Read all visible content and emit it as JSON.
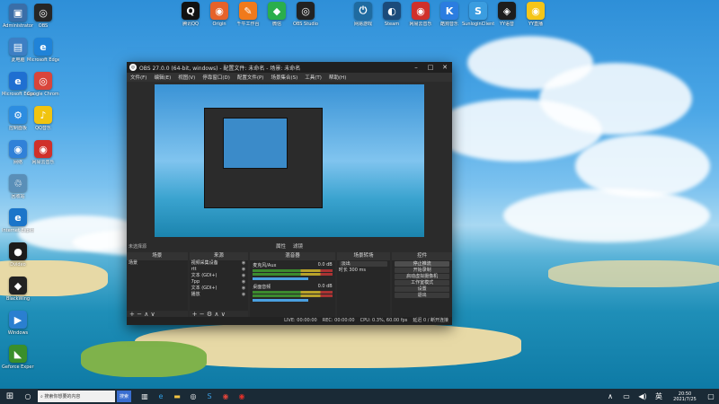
{
  "desktop": {
    "icons": [
      {
        "label": "Administrator",
        "glyph": "▣",
        "color": "#3a6ea8"
      },
      {
        "label": "此电脑",
        "glyph": "▤",
        "color": "#3d7fc4"
      },
      {
        "label": "Microsoft Edge",
        "glyph": "e",
        "color": "#1f6fd1"
      },
      {
        "label": "控制面板",
        "glyph": "⚙",
        "color": "#2d8de0"
      },
      {
        "label": "网络",
        "glyph": "◉",
        "color": "#3081d8"
      },
      {
        "label": "回收站",
        "glyph": "♲",
        "color": "#5a8fb8"
      },
      {
        "label": "Internet Explorer",
        "glyph": "e",
        "color": "#1b75c9"
      },
      {
        "label": "Dvideo",
        "glyph": "●",
        "color": "#1c1c1c"
      },
      {
        "label": "BlackWing",
        "glyph": "◆",
        "color": "#222"
      },
      {
        "label": "Windows",
        "glyph": "▶",
        "color": "#2a7fd0"
      },
      {
        "label": "Geforce Experience",
        "glyph": "◣",
        "color": "#3a8f2a"
      },
      {
        "label": "OBS",
        "glyph": "◎",
        "color": "#262626"
      },
      {
        "label": "Microsoft Edge",
        "glyph": "e",
        "color": "#2083d8"
      },
      {
        "label": "Google Chrome",
        "glyph": "◎",
        "color": "#d9453b"
      },
      {
        "label": "QQ音乐",
        "glyph": "♪",
        "color": "#f1c40f"
      },
      {
        "label": "网易云音乐",
        "glyph": "◉",
        "color": "#d0302a"
      }
    ],
    "top_icons": [
      {
        "label": "腾讯QQ",
        "glyph": "Q",
        "color": "#111"
      },
      {
        "label": "Origin",
        "glyph": "◉",
        "color": "#e5622a"
      },
      {
        "label": "千牛工作台",
        "glyph": "✎",
        "color": "#f07a1c"
      },
      {
        "label": "微信",
        "glyph": "◆",
        "color": "#2aae4b"
      },
      {
        "label": "OBS Studio",
        "glyph": "◎",
        "color": "#222"
      },
      {
        "label": "网易游戏",
        "glyph": "⏻",
        "color": "#1f6ba0"
      },
      {
        "label": "Steam",
        "glyph": "◐",
        "color": "#1b4b7a"
      },
      {
        "label": "网易云音乐",
        "glyph": "◉",
        "color": "#d0302a"
      },
      {
        "label": "酷狗音乐",
        "glyph": "K",
        "color": "#2b7de0"
      },
      {
        "label": "SunloginClient",
        "glyph": "S",
        "color": "#3b9de0"
      },
      {
        "label": "YY语音",
        "glyph": "◈",
        "color": "#1d1d1d"
      },
      {
        "label": "YY直播",
        "glyph": "◉",
        "color": "#f5c518"
      }
    ]
  },
  "obs": {
    "title": "OBS 27.0.0 (64-bit, windows) - 配置文件: 未命名 - 场景: 未命名",
    "menu": [
      "文件(F)",
      "编辑(E)",
      "视图(V)",
      "停靠窗口(D)",
      "配置文件(P)",
      "场景集合(S)",
      "工具(T)",
      "帮助(H)"
    ],
    "no_source": "未选择源",
    "preview_controls": [
      "属性",
      "滤镜"
    ],
    "docks": {
      "scenes": {
        "header": "场景",
        "items": [
          "场景"
        ]
      },
      "sources": {
        "header": "来源",
        "items": [
          "视频采集设备",
          "rtt",
          "文本 (GDI+)",
          "7pp",
          "文本 (GDI+)",
          "播放"
        ]
      },
      "mixer": {
        "header": "混音器",
        "channels": [
          {
            "name": "麦克风/Aux",
            "level": "0.0 dB"
          },
          {
            "name": "桌面音频",
            "level": "0.0 dB"
          }
        ]
      },
      "transitions": {
        "header": "场景转场",
        "type": "淡出",
        "duration_label": "时长",
        "duration": "300 ms"
      },
      "controls": {
        "header": "控件",
        "buttons": [
          "停止推流",
          "开始录制",
          "启动虚拟摄像机",
          "工作室模式",
          "设置",
          "退出"
        ]
      }
    },
    "status": {
      "live": "LIVE: 00:00:00",
      "rec": "REC: 00:00:00",
      "cpu": "CPU: 0.3%, 60.00 fps",
      "delay": "延迟 0 / 断开连接"
    }
  },
  "taskbar": {
    "search_placeholder": "搜索你想要的内容",
    "search_button": "搜索",
    "lang": "英",
    "time": "20:50",
    "date": "2021/7/25"
  }
}
